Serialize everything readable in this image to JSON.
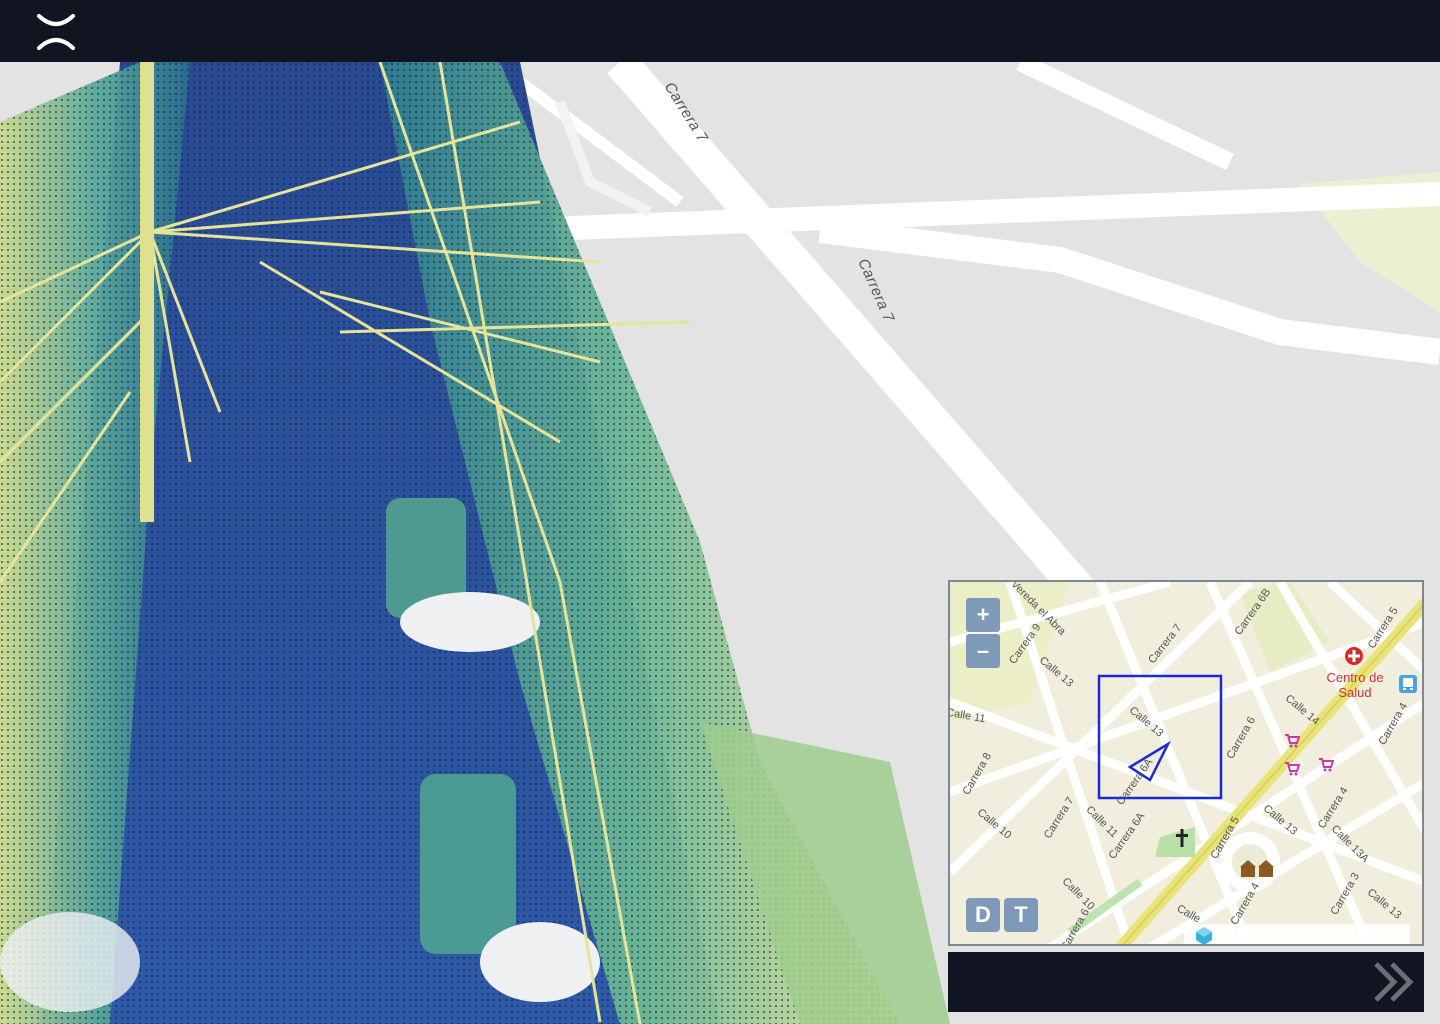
{
  "app": {
    "logo": "brand-logo"
  },
  "map": {
    "street_labels": [
      "Carrera 7",
      "Carrera 7"
    ]
  },
  "minimap": {
    "zoom_in_label": "+",
    "zoom_out_label": "–",
    "mode_d_label": "D",
    "mode_t_label": "T",
    "poi_name": "Centro de Salud",
    "street_labels": [
      "Vereda el Abra",
      "Carrera 9",
      "Calle 13",
      "Carrera 7",
      "Carrera 6B",
      "Carrera 5",
      "Calle 14",
      "Carrera 6",
      "Carrera 4",
      "Calle 13",
      "Carrera 6A",
      "Carrera 8",
      "Calle 10",
      "Carrera 7",
      "Calle 11",
      "Carrera 6A",
      "Calle 13",
      "Carrera 4",
      "Calle 13A",
      "Carrera 5",
      "Calle 10",
      "Carrera 6",
      "Calle",
      "Carrera 4",
      "Carrera 3",
      "Calle 13",
      "Calle 11"
    ],
    "icons": [
      "hospital-icon",
      "bus-icon",
      "shop-icon",
      "church-icon",
      "police-icon",
      "layers-icon"
    ]
  },
  "panel": {
    "expand_icon": "double-chevron-right-icon"
  }
}
